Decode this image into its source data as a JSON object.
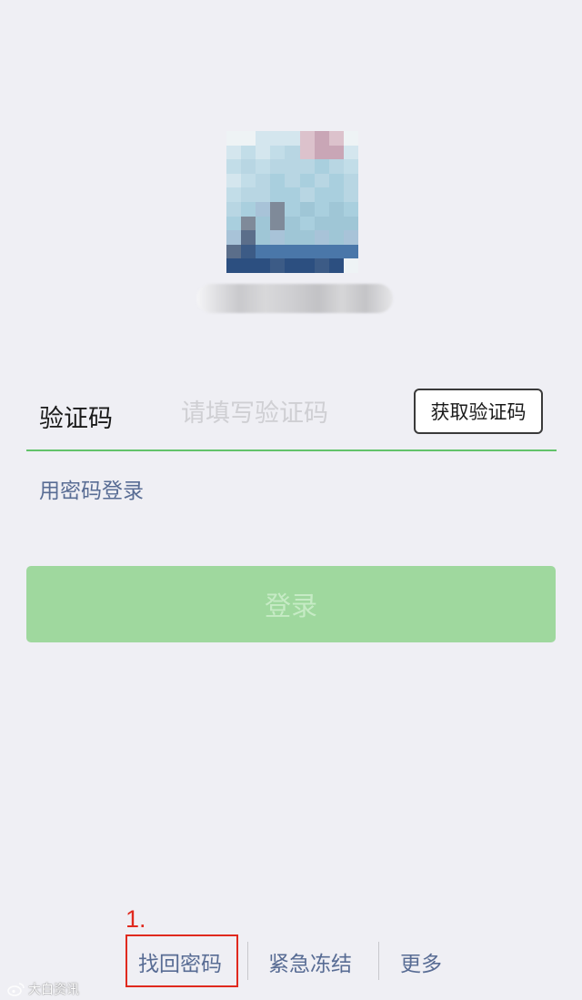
{
  "avatar": {
    "description_hidden": true,
    "palette": [
      "#eef3f5",
      "#d4e6ee",
      "#c2dde8",
      "#b8d6e3",
      "#a9cfde",
      "#9fc6d6",
      "#dcc2cc",
      "#c9a6b6",
      "#7f8a99",
      "#5b6e8a",
      "#3c5b86",
      "#2c4f80",
      "#4a77a9",
      "#a8c3d8"
    ]
  },
  "code_row": {
    "label": "验证码",
    "placeholder": "请填写验证码",
    "value": "",
    "get_code_label": "获取验证码"
  },
  "password_login_label": "用密码登录",
  "login_button_label": "登录",
  "annotation": {
    "number": "1.",
    "color": "#e0291e"
  },
  "bottom_links": {
    "forgot_password": "找回密码",
    "emergency_freeze": "紧急冻结",
    "more": "更多"
  },
  "colors": {
    "background": "#efeff4",
    "accent_green": "#62c36a",
    "login_disabled": "#9fd89e",
    "link_blue": "#586c94"
  },
  "watermark": {
    "text": "大白资讯"
  }
}
